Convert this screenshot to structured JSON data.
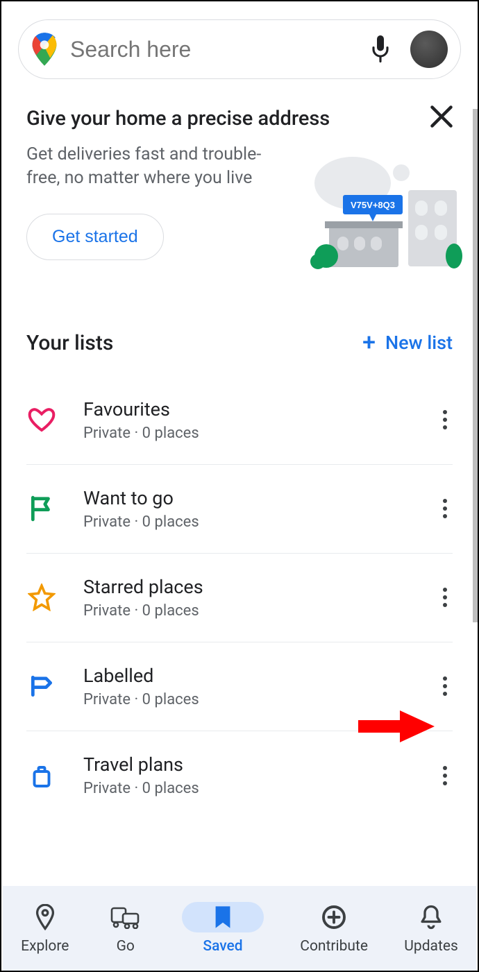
{
  "search": {
    "placeholder": "Search here"
  },
  "promo": {
    "title": "Give your home a precise address",
    "body": "Get deliveries fast and trouble-free, no matter where you live",
    "cta": "Get started",
    "pluscode": "V75V+8Q3"
  },
  "lists_header": {
    "title": "Your lists",
    "new_label": "New list"
  },
  "lists": [
    {
      "name": "Favourites",
      "sub": "Private · 0 places",
      "icon": "heart",
      "color": "#e91e63"
    },
    {
      "name": "Want to go",
      "sub": "Private · 0 places",
      "icon": "flag",
      "color": "#0f9d58"
    },
    {
      "name": "Starred places",
      "sub": "Private · 0 places",
      "icon": "star",
      "color": "#f29900"
    },
    {
      "name": "Labelled",
      "sub": "Private · 0 places",
      "icon": "label",
      "color": "#1a73e8"
    },
    {
      "name": "Travel plans",
      "sub": "Private · 0 places",
      "icon": "suitcase",
      "color": "#1a73e8"
    }
  ],
  "bottom_nav": {
    "items": [
      {
        "label": "Explore",
        "icon": "pin"
      },
      {
        "label": "Go",
        "icon": "transit"
      },
      {
        "label": "Saved",
        "icon": "bookmark",
        "active": true
      },
      {
        "label": "Contribute",
        "icon": "plus-circle"
      },
      {
        "label": "Updates",
        "icon": "bell"
      }
    ]
  }
}
